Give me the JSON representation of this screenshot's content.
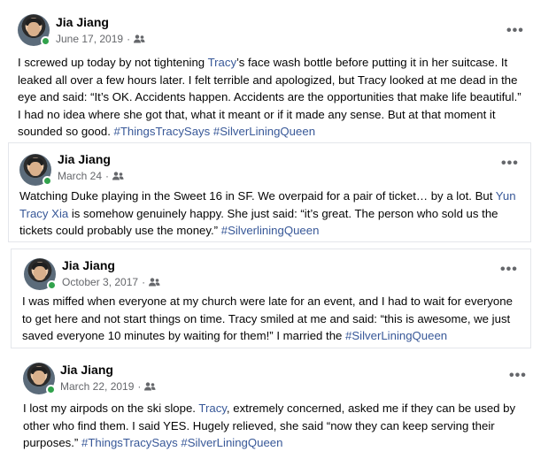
{
  "posts": [
    {
      "author": "Jia Jiang",
      "date": "June 17, 2019",
      "audience_icon": "friends-icon",
      "more_label": "•••",
      "segments": [
        {
          "t": "I screwed up today by not tightening "
        },
        {
          "t": "Tracy",
          "link": true
        },
        {
          "t": "’s face wash bottle before putting it in her suitcase. It leaked all over a few hours later. I felt terrible and apologized, but Tracy looked at me dead in the eye and said: “It’s OK. Accidents happen. Accidents are the opportunities that make life beautiful.” I had no idea where she got that, what it meant or if it made any sense. But at that moment it sounded so good. "
        },
        {
          "t": "#ThingsTracySays",
          "link": true
        },
        {
          "t": " "
        },
        {
          "t": "#SilverLiningQueen",
          "link": true
        }
      ]
    },
    {
      "author": "Jia Jiang",
      "date": "March 24",
      "audience_icon": "friends-icon",
      "more_label": "•••",
      "segments": [
        {
          "t": "Watching Duke playing in the Sweet 16 in SF. We overpaid for a pair of ticket… by a lot. But "
        },
        {
          "t": "Yun Tracy Xia",
          "link": true
        },
        {
          "t": " is somehow genuinely happy. She just said: “it’s great. The person who sold us the tickets could probably use the money.” "
        },
        {
          "t": "#SilverliningQueen",
          "link": true
        }
      ]
    },
    {
      "author": "Jia Jiang",
      "date": "October 3, 2017",
      "audience_icon": "friends-icon",
      "more_label": "•••",
      "segments": [
        {
          "t": "I was miffed when everyone at my church were late for an event, and I had to wait for everyone to get here and not start things on time. Tracy smiled at me and said: “this is awesome, we just saved everyone 10 minutes by waiting for them!” I married the "
        },
        {
          "t": "#SilverLiningQueen",
          "link": true
        }
      ]
    },
    {
      "author": "Jia Jiang",
      "date": "March 22, 2019",
      "audience_icon": "friends-icon",
      "more_label": "•••",
      "segments": [
        {
          "t": "I lost my airpods on the ski slope. "
        },
        {
          "t": "Tracy",
          "link": true
        },
        {
          "t": ", extremely concerned, asked me if they can be used by other who find them. I said YES. Hugely relieved, she said “now they can keep serving their purposes.” "
        },
        {
          "t": "#ThingsTracySays",
          "link": true
        },
        {
          "t": " "
        },
        {
          "t": "#SilverLiningQueen",
          "link": true
        }
      ]
    }
  ],
  "colors": {
    "link": "#385898",
    "meta": "#65676b",
    "online": "#31a24c"
  }
}
